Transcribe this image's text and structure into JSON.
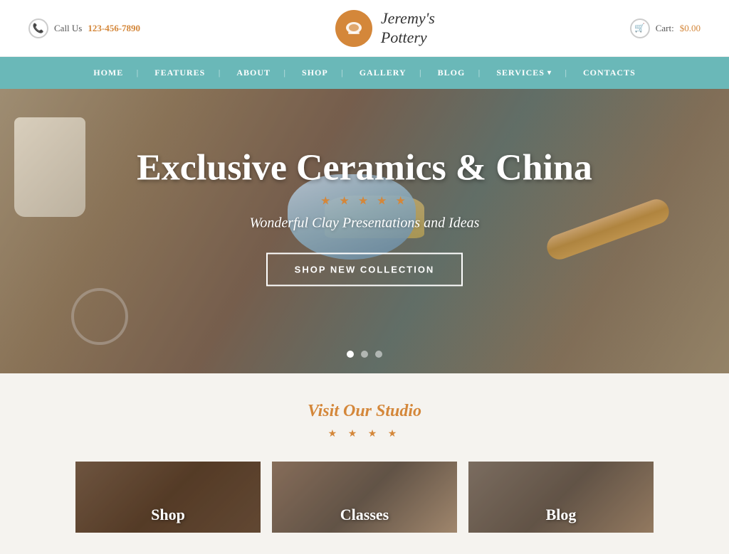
{
  "header": {
    "phone_label": "Call Us",
    "phone_number": "123-456-7890",
    "logo_line1": "Jeremy's",
    "logo_line2": "Pottery",
    "cart_label": "Cart:",
    "cart_amount": "$0.00"
  },
  "nav": {
    "items": [
      {
        "id": "home",
        "label": "HOME",
        "active": true
      },
      {
        "id": "features",
        "label": "FEATURES",
        "active": false
      },
      {
        "id": "about",
        "label": "ABOUT",
        "active": false
      },
      {
        "id": "shop",
        "label": "SHOP",
        "active": false
      },
      {
        "id": "gallery",
        "label": "GALLERY",
        "active": false
      },
      {
        "id": "blog",
        "label": "BLOG",
        "active": false
      },
      {
        "id": "services",
        "label": "SERVICES",
        "active": false,
        "has_dropdown": true
      },
      {
        "id": "contacts",
        "label": "CONTACTS",
        "active": false
      }
    ]
  },
  "hero": {
    "title": "Exclusive Ceramics & China",
    "subtitle": "Wonderful Clay Presentations and Ideas",
    "stars": "★ ★ ★ ★ ★",
    "cta_button": "SHOP NEW COLLECTION",
    "dots": [
      {
        "active": true
      },
      {
        "active": false
      },
      {
        "active": false
      }
    ]
  },
  "visit": {
    "title": "Visit Our Studio",
    "stars": "★ ★ ★ ★"
  },
  "studio_cards": [
    {
      "id": "shop",
      "label": "Shop"
    },
    {
      "id": "classes",
      "label": "Classes"
    },
    {
      "id": "blog",
      "label": "Blog"
    }
  ]
}
